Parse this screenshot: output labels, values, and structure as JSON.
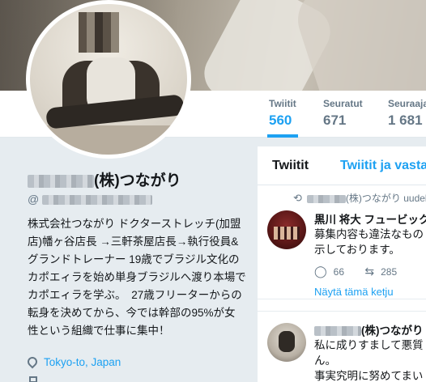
{
  "banner": {
    "description_icon": "cover-photo"
  },
  "stats": [
    {
      "label": "Twiitit",
      "value": "560",
      "active": true
    },
    {
      "label": "Seuratut",
      "value": "671",
      "active": false
    },
    {
      "label": "Seuraajat",
      "value": "1 681",
      "active": false
    }
  ],
  "profile": {
    "name_suffix": "(株)つながり",
    "handle_prefix": "@",
    "bio": "株式会社つながり ドクターストレッチ(加盟店)幡ヶ谷店長 →三軒茶屋店長→執行役員&グランドトレーナー 19歳でブラジル文化のカポエィラを始め単身ブラジルへ渡り本場でカポエィラを学ぶ。　27歳フリーターからの転身を決めてから、今では幹部の95%が女性という組織で仕事に集中！",
    "location": "Tokyo-to, Japan"
  },
  "feed": {
    "tabs": [
      "Twiitit",
      "Twiitit ja vastaukset"
    ],
    "tweets": [
      {
        "retweeted_by_suffix": "(株)つながり uudelleentwiittasi",
        "author": "黒川 将大 フュービック",
        "lines": [
          "募集内容も違法なもの",
          "示しております。"
        ],
        "replies": "66",
        "retweets": "285",
        "thread_link": "Näytä tämä ketju"
      },
      {
        "author_suffix": "(株)つながり",
        "lines": [
          "私に成りすまして悪質",
          "ん。",
          "事実究明に努めてまい"
        ]
      }
    ]
  },
  "colors": {
    "accent": "#1da1f2",
    "muted": "#657786",
    "background": "#e6ecf0"
  }
}
